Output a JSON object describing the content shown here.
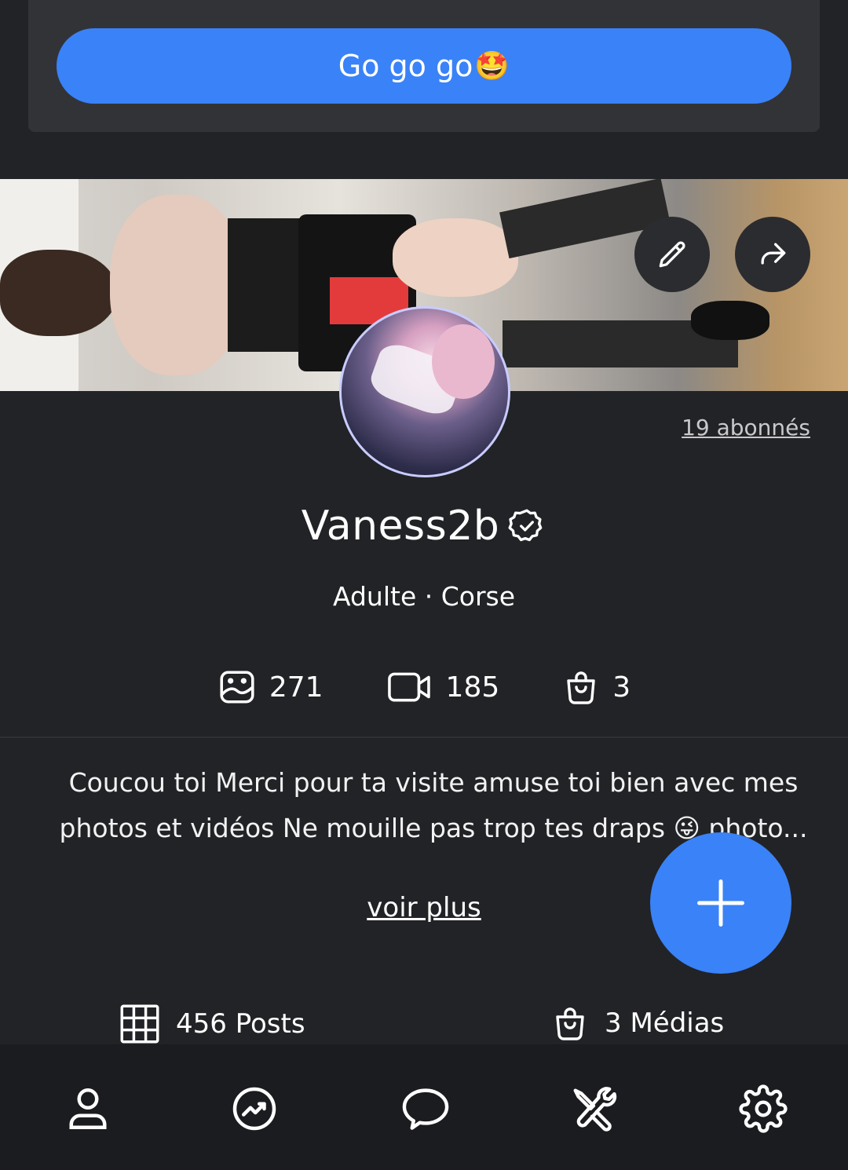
{
  "promo": {
    "button_label": "Go go go",
    "button_emoji": "🤩",
    "accent": "#3a82f7"
  },
  "profile": {
    "subscribers": "19 abonnés",
    "name": "Vaness2b",
    "category": "Adulte · Corse",
    "stats": {
      "photos": "271",
      "videos": "185",
      "shop": "3"
    },
    "bio_line1": "Coucou toi Merci pour ta visite amuse toi bien avec mes",
    "bio_line2": "photos et vidéos Ne mouille pas trop tes draps 😜 photo...",
    "see_more": "voir plus"
  },
  "content_tabs": {
    "posts": "456 Posts",
    "media": "3 Médias"
  },
  "icons": [
    "edit-icon",
    "share-icon",
    "verified-badge-icon",
    "image-icon",
    "video-icon",
    "shopping-bag-icon",
    "plus-icon",
    "grid-icon",
    "user-icon",
    "trending-icon",
    "chat-icon",
    "tools-icon",
    "settings-icon"
  ]
}
